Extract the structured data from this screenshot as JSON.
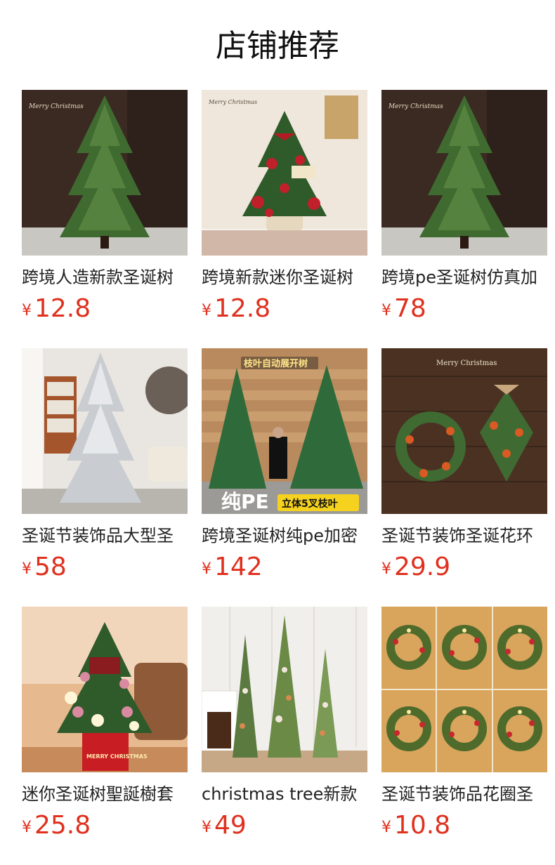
{
  "page": {
    "title": "店铺推荐"
  },
  "colors": {
    "price": "#e0301e",
    "title": "#111111",
    "text": "#222222"
  },
  "products": [
    {
      "name": "跨境人造新款圣诞树",
      "currency": "¥",
      "price": "12.8",
      "image": "flocked-free green pine christmas tree on dark wood background",
      "image_text": "Merry Christmas"
    },
    {
      "name": "跨境新款迷你圣诞树",
      "currency": "¥",
      "price": "12.8",
      "image": "mini christmas tree with red ornaments and bows",
      "image_text": "Merry Christmas"
    },
    {
      "name": "跨境pe圣诞树仿真加",
      "currency": "¥",
      "price": "78",
      "image": "green pine christmas tree on dark wood background",
      "image_text": "Merry Christmas"
    },
    {
      "name": "圣诞节装饰品大型圣",
      "currency": "¥",
      "price": "58",
      "image": "white flocked snow christmas tree in living room",
      "image_text": ""
    },
    {
      "name": "跨境圣诞树纯pe加密",
      "currency": "¥",
      "price": "142",
      "image": "two large pe christmas trees with man in warehouse",
      "image_text": "枝叶自动展开树",
      "image_text_2": "纯PE",
      "image_text_3": "立体5叉枝叶"
    },
    {
      "name": "圣诞节装饰圣诞花环",
      "currency": "¥",
      "price": "29.9",
      "image": "christmas wreaths on wooden wall",
      "image_text": "Merry Christmas"
    },
    {
      "name": "迷你圣诞树聖誕樹套",
      "currency": "¥",
      "price": "25.8",
      "image": "mini decorated christmas tree on red gift box",
      "image_text": "MERRY CHRISTMAS"
    },
    {
      "name": "christmas tree新款",
      "currency": "¥",
      "price": "49",
      "image": "three slim pencil christmas trees near fireplace",
      "image_text": ""
    },
    {
      "name": "圣诞节装饰品花圈圣",
      "currency": "¥",
      "price": "10.8",
      "image": "grid of six lit christmas wreaths",
      "image_text": ""
    }
  ]
}
